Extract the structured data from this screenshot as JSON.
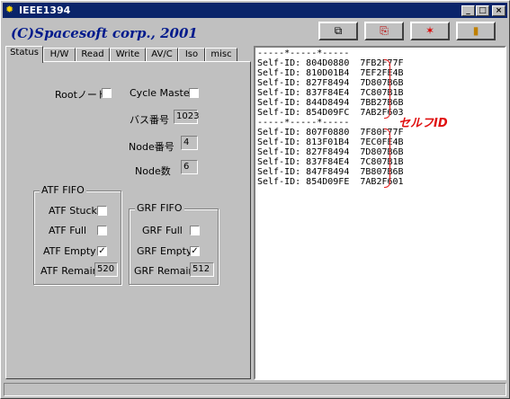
{
  "window": {
    "title": "IEEE1394",
    "minimize": "_",
    "maximize": "□",
    "close": "×"
  },
  "header": {
    "brand": "(C)Spacesoft corp., 2001",
    "tools": [
      {
        "name": "copy-tool-icon",
        "glyph": "⧉"
      },
      {
        "name": "paste-tool-icon",
        "glyph": "⎘"
      },
      {
        "name": "clear-tool-icon",
        "glyph": "✶"
      },
      {
        "name": "exit-tool-icon",
        "glyph": "▮"
      }
    ]
  },
  "tabs": [
    "Status",
    "H/W",
    "Read",
    "Write",
    "AV/C",
    "Iso",
    "misc"
  ],
  "status": {
    "root_label": "Rootノード",
    "root_checked": "",
    "cycle_master_label": "Cycle Master",
    "cycle_master_checked": "",
    "bus_number_label": "バス番号",
    "bus_number": "1023",
    "node_number_label": "Node番号",
    "node_number": "4",
    "node_count_label": "Node数",
    "node_count": "6",
    "atf": {
      "title": "ATF FIFO",
      "stuck_label": "ATF Stuck",
      "stuck": "",
      "full_label": "ATF Full",
      "full": "",
      "empty_label": "ATF Empty",
      "empty": "✓",
      "remain_label": "ATF Remain",
      "remain": "520"
    },
    "grf": {
      "title": "GRF FIFO",
      "full_label": "GRF Full",
      "full": "",
      "empty_label": "GRF Empty",
      "empty": "✓",
      "remain_label": "GRF Remain",
      "remain": "512"
    }
  },
  "log": {
    "lines": [
      "-----*-----*-----",
      "Self-ID: 804D0880  7FB2F77F",
      "Self-ID: 810D01B4  7EF2FE4B",
      "Self-ID: 827F8494  7D807B6B",
      "Self-ID: 837F84E4  7C807B1B",
      "Self-ID: 844D8494  7BB27B6B",
      "Self-ID: 854D09FC  7AB2F603",
      "-----*-----*-----",
      "Self-ID: 807F0880  7F80F77F",
      "Self-ID: 813F01B4  7EC0FE4B",
      "Self-ID: 827F8494  7D807B6B",
      "Self-ID: 837F84E4  7C807B1B",
      "Self-ID: 847F8494  7B807B6B",
      "Self-ID: 854D09FE  7AB2F601"
    ],
    "annotation": "セルフID"
  },
  "colors": {
    "brand": "#001a8c",
    "annotation": "#e01010",
    "titlebar": "#0a246a"
  }
}
